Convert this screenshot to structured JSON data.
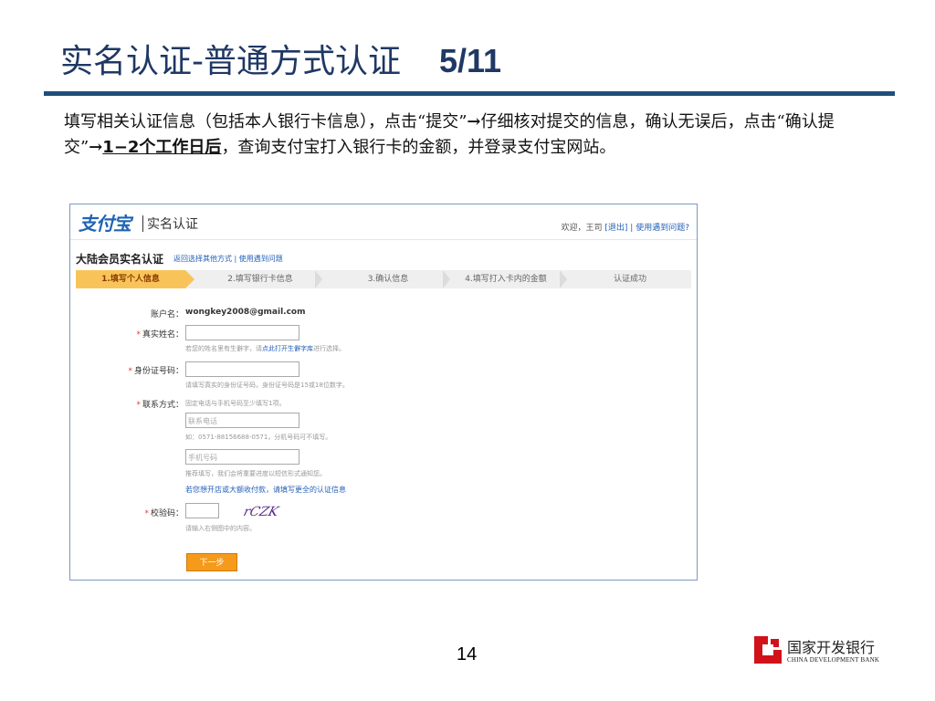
{
  "slide": {
    "title": "实名认证-普通方式认证",
    "page_progress": "5/11",
    "intro": {
      "part1": "填写相关认证信息（包括本人银行卡信息），点击“提交”",
      "arrow1": "→",
      "part2": "仔细核对提交的信息，确认无误后，点击“确认提交”",
      "arrow2": "→",
      "bold": "1−2个工作日后",
      "part3": "，查询支付宝打入银行卡的金额，并登录支付宝网站。"
    },
    "page_number": "14",
    "bank": {
      "name_cn": "国家开发银行",
      "name_en": "CHINA DEVELOPMENT BANK"
    }
  },
  "alipay": {
    "logo": "支付宝",
    "section_name": "实名认证",
    "welcome": {
      "text": "欢迎，王司",
      "logout": "[退出]",
      "sep": "|",
      "help": "使用遇到问题?"
    },
    "section_title": "大陆会员实名认证",
    "section_links": {
      "other_method": "返回选择其他方式",
      "sep": "|",
      "help": "使用遇到问题"
    },
    "steps": [
      "1.填写个人信息",
      "2.填写银行卡信息",
      "3.确认信息",
      "4.填写打入卡内的金额",
      "认证成功"
    ],
    "active_step": 1,
    "form": {
      "account_label": "账户名：",
      "account_value": "wongkey2008@gmail.com",
      "required_mark": "*",
      "name_label": "真实姓名：",
      "name_hint": "若您的姓名里有生僻字，请",
      "name_hint_link": "点此打开生僻字库",
      "name_hint_tail": "进行选择。",
      "id_label": "身份证号码：",
      "id_hint": "请填写真实的身份证号码，身份证号码是15或18位数字。",
      "contact_label": "联系方式：",
      "contact_hint": "固定电话与手机号码至少填写1项。",
      "phone_placeholder": "联系电话",
      "phone_hint": "如：0571-88156688-0571，分机号码可不填写。",
      "mobile_placeholder": "手机号码",
      "mobile_hint": "推荐填写，我们会将重要进度以短信形式通知您。",
      "merchant_link": "若您想开店或大额收付款，请填写更全的认证信息",
      "captcha_label": "校验码：",
      "captcha_text": "rCZK",
      "captcha_hint": "请输入右侧图中的内容。",
      "next_button": "下一步"
    }
  }
}
